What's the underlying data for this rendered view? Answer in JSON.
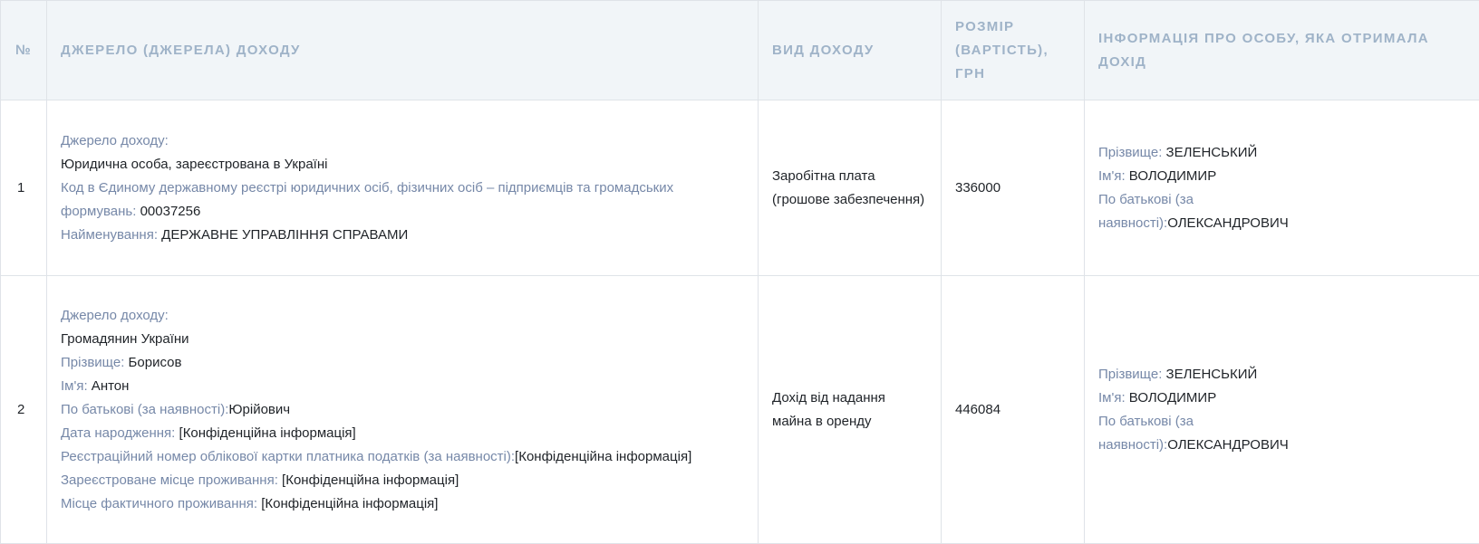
{
  "table": {
    "headers": {
      "num": "№",
      "source": "ДЖЕРЕЛО (ДЖЕРЕЛА) ДОХОДУ",
      "type": "ВИД ДОХОДУ",
      "amount": "РОЗМІР (ВАРТІСТЬ), ГРН",
      "recipient": "ІНФОРМАЦІЯ ПРО ОСОБУ, ЯКА ОТРИМАЛА ДОХІД"
    },
    "rows": [
      {
        "num": "1",
        "source": {
          "heading": "Джерело доходу:",
          "kind": "Юридична особа, зареєстрована в Україні",
          "code_label": "Код в Єдиному державному реєстрі юридичних осіб, фізичних осіб – підприємців та громадських формувань:",
          "code_value": " 00037256",
          "name_label": "Найменування:",
          "name_value": " ДЕРЖАВНЕ УПРАВЛІННЯ СПРАВАМИ"
        },
        "type": "Заробітна плата (грошове забезпечення)",
        "amount": "336000",
        "recipient": {
          "surname_label": "Прізвище:",
          "surname_value": " ЗЕЛЕНСЬКИЙ",
          "name_label": "Ім'я:",
          "name_value": " ВОЛОДИМИР",
          "patronymic_label": "По батькові (за наявності):",
          "patronymic_value": "ОЛЕКСАНДРОВИЧ"
        }
      },
      {
        "num": "2",
        "source": {
          "heading": "Джерело доходу:",
          "kind": "Громадянин України",
          "surname_label": "Прізвище:",
          "surname_value": " Борисов",
          "name_label": "Ім'я:",
          "name_value": " Антон",
          "patronymic_label": "По батькові (за наявності):",
          "patronymic_value": "Юрійович",
          "birth_label": "Дата народження:",
          "birth_value": " [Конфіденційна інформація]",
          "taxid_label": "Реєстраційний номер облікової картки платника податків (за наявності):",
          "taxid_value": "[Конфіденційна інформація]",
          "registered_label": "Зареєстроване місце проживання:",
          "registered_value": " [Конфіденційна інформація]",
          "actual_label": "Місце фактичного проживання:",
          "actual_value": " [Конфіденційна інформація]"
        },
        "type": "Дохід від надання майна в оренду",
        "amount": "446084",
        "recipient": {
          "surname_label": "Прізвище:",
          "surname_value": " ЗЕЛЕНСЬКИЙ",
          "name_label": "Ім'я:",
          "name_value": " ВОЛОДИМИР",
          "patronymic_label": "По батькові (за наявності):",
          "patronymic_value": "ОЛЕКСАНДРОВИЧ"
        }
      }
    ]
  }
}
